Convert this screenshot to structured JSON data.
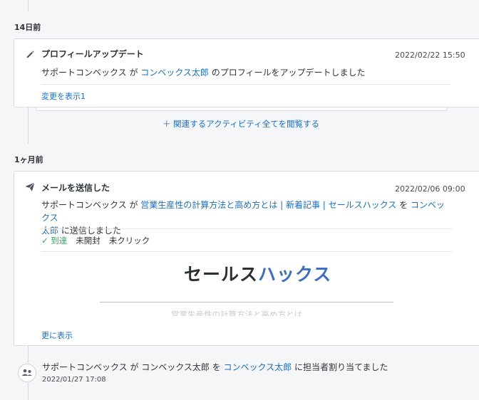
{
  "groups": [
    {
      "date_label": "14日前",
      "activity": {
        "icon": "pencil-icon",
        "title": "プロフィールアップデート",
        "timestamp": "2022/02/22 15:50",
        "text_1": "サポートコンベックス が ",
        "link_1": "コンベックス太郎",
        "text_2": " のプロフィールをアップデートしました",
        "show_changes": "変更を表示1"
      },
      "related_link": "＋ 関連するアクティビティ全てを閲覧する"
    },
    {
      "date_label": "1ヶ月前",
      "activity": {
        "icon": "paper-plane-icon",
        "title": "メールを送信した",
        "timestamp": "2022/02/06 09:00",
        "text_1": "サポートコンベックス が ",
        "link_1": "営業生産性の計算方法と高め方とは | 新着記事 | セールスハックス",
        "text_2": " を ",
        "link_2a": "コンベックス",
        "link_2b": "太郎",
        "text_3": " に送信しました",
        "status": {
          "delivered": "✓ 到達",
          "opened": "未開封",
          "clicked": "未クリック"
        },
        "preview": {
          "logo_part1": "セールス",
          "logo_part2": "ハックス",
          "faded_heading": "営業生産性の計算方法と高め方とは"
        },
        "show_more": "更に表示"
      }
    }
  ],
  "assignment": {
    "icon": "assign-user-icon",
    "text_1": "サポートコンベックス が コンベックス太郎 を ",
    "link": "コンベックス太郎",
    "text_2": " に担当者割り当てました",
    "timestamp": "2022/01/27 17:08"
  },
  "colors": {
    "link": "#1a6fc4",
    "status_ok": "#2ea05c",
    "logo_dark": "#2b2f36",
    "logo_blue": "#3b6fc4"
  }
}
